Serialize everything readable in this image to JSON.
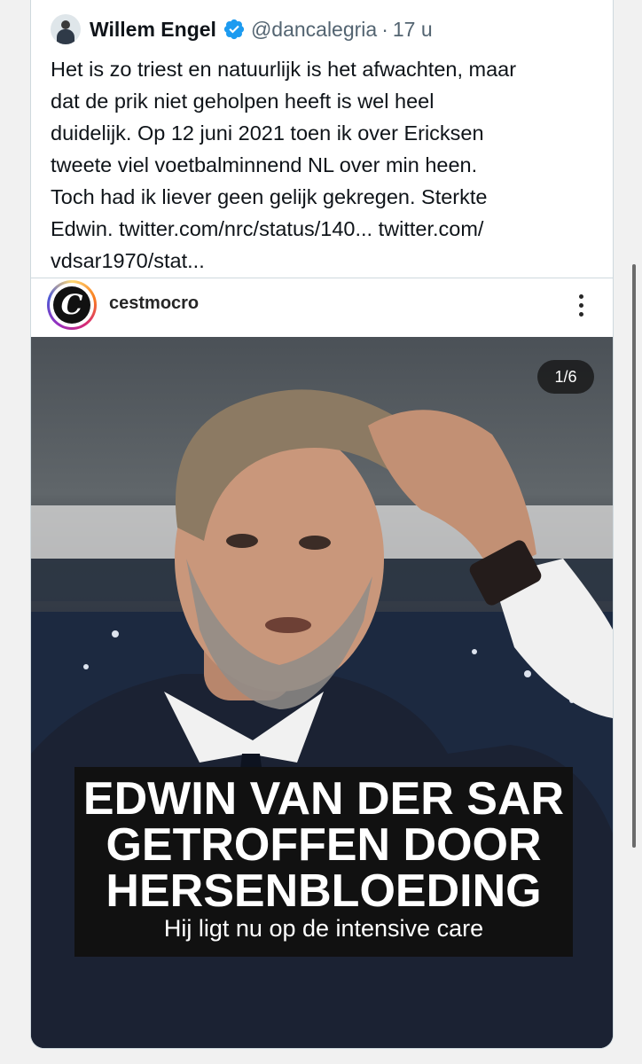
{
  "tweet": {
    "author_name": "Willem Engel",
    "handle": "@dancalegria",
    "separator": "·",
    "time": "17 u",
    "lines": [
      "Het is zo triest en natuurlijk is het afwachten, maar",
      "dat de prik niet geholpen heeft is wel heel",
      "duidelijk. Op 12 juni 2021 toen ik over Ericksen",
      "tweete viel voetbalminnend NL over min heen.",
      "Toch had ik liever geen gelijk gekregen. Sterkte",
      "Edwin. twitter.com/nrc/status/140... twitter.com/",
      "vdsar1970/stat..."
    ]
  },
  "embed": {
    "account": "cestmocro",
    "avatar_letter": "C",
    "counter": "1/6",
    "headline": [
      "EDWIN VAN DER SAR",
      "GETROFFEN DOOR",
      "HERSENBLOEDING"
    ],
    "subheadline": "Hij ligt nu op de intensive care"
  },
  "colors": {
    "text_primary": "#0f1419",
    "text_secondary": "#536471",
    "verified_blue": "#1d9bf0",
    "border": "#cfd9de"
  },
  "icons": [
    "verified-badge-icon",
    "more-options-icon"
  ]
}
